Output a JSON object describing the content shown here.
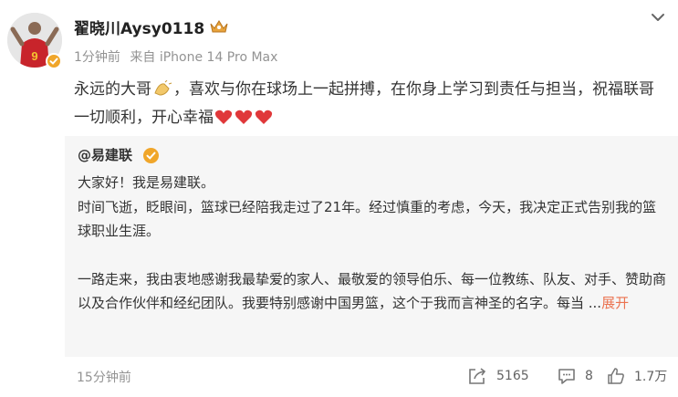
{
  "post": {
    "author": "翟晓川Aysy0118",
    "time": "1分钟前",
    "source": "来自 iPhone 14 Pro Max",
    "text_part1": "永远的大哥",
    "text_part2": "，喜欢与你在球场上一起拼搏，在你身上学习到责任与担当，祝福联哥一切顺利，开心幸福",
    "avatar_jersey_number": "9",
    "icons": {
      "verified": "verified-badge-icon",
      "crown": "crown-icon",
      "more": "chevron-down-icon",
      "clap": "clap-emoji-icon",
      "heart": "heart-emoji-icon"
    }
  },
  "repost": {
    "author": "@易建联",
    "lines": {
      "l1": "大家好！我是易建联。",
      "l2": "时间飞逝，眨眼间，篮球已经陪我走过了21年。经过慎重的考虑，今天，我决定正式告别我的篮球职业生涯。",
      "l3": "一路走来，我由衷地感谢我最挚爱的家人、最敬爱的领导伯乐、每一位教练、队友、对手、赞助商以及合作伙伴和经纪团队。我要特别感谢中国男篮，这个于我而言神圣的名字。每当 ..."
    },
    "expand_label": "展开",
    "time": "15分钟前",
    "stats": {
      "reposts": "5165",
      "comments": "8",
      "likes": "1.7万"
    }
  },
  "colors": {
    "accent": "#eb7350",
    "verified": "#f0a62a",
    "heart": "#e0383a",
    "repost_bg": "#f6f6f6",
    "meta_text": "#939393"
  }
}
